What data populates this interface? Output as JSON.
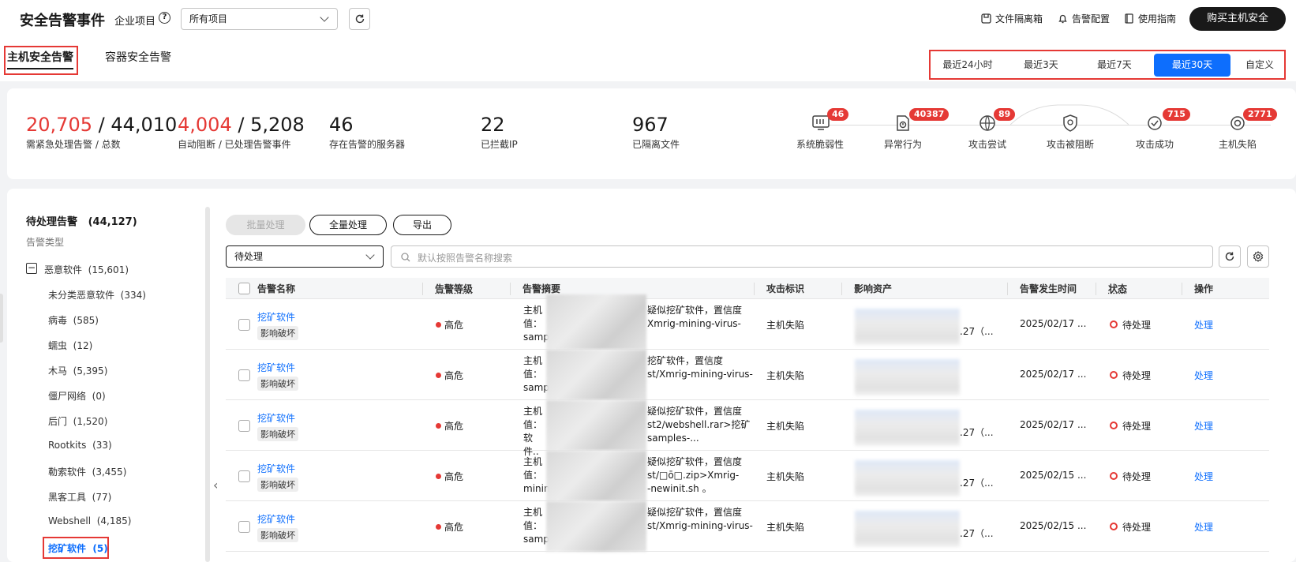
{
  "header": {
    "title": "安全告警事件",
    "project_label": "企业项目",
    "help_icon": "?",
    "project_select": "所有项目",
    "links": [
      {
        "label": "文件隔离箱",
        "icon": "file-box-icon"
      },
      {
        "label": "告警配置",
        "icon": "bell-icon"
      },
      {
        "label": "使用指南",
        "icon": "book-icon"
      }
    ],
    "buy_button": "购买主机安全"
  },
  "tabs": [
    "主机安全告警",
    "容器安全告警"
  ],
  "time_ranges": [
    "最近24小时",
    "最近3天",
    "最近7天",
    "最近30天",
    "自定义"
  ],
  "time_range_active": "最近30天",
  "stats": [
    {
      "value_red": "20,705",
      "sep": " / ",
      "value": "44,010",
      "label": "需紧急处理告警 / 总数"
    },
    {
      "value_red": "4,004",
      "sep": " / ",
      "value": "5,208",
      "label": "自动阻断 / 已处理告警事件"
    },
    {
      "value": "46",
      "label": "存在告警的服务器"
    },
    {
      "value": "22",
      "label": "已拦截IP"
    },
    {
      "value": "967",
      "label": "已隔离文件"
    }
  ],
  "flow": [
    {
      "label": "系统脆弱性",
      "badge": "46",
      "icon": "vulnerability-icon"
    },
    {
      "label": "异常行为",
      "badge": "40387",
      "icon": "abnormal-behavior-icon"
    },
    {
      "label": "攻击尝试",
      "badge": "89",
      "icon": "globe-attack-icon"
    },
    {
      "label": "攻击被阻断",
      "badge": "",
      "icon": "shield-blocked-icon"
    },
    {
      "label": "攻击成功",
      "badge": "715",
      "icon": "attack-success-icon"
    },
    {
      "label": "主机失陷",
      "badge": "2771",
      "icon": "host-compromised-icon"
    }
  ],
  "sidebar": {
    "title": "待处理告警",
    "count": "(44,127)",
    "subtitle": "告警类型",
    "group": {
      "label": "恶意软件",
      "count": "(15,601)"
    },
    "items": [
      {
        "label": "未分类恶意软件",
        "count": "(334)"
      },
      {
        "label": "病毒",
        "count": "(585)"
      },
      {
        "label": "蠕虫",
        "count": "(12)"
      },
      {
        "label": "木马",
        "count": "(5,395)"
      },
      {
        "label": "僵尸网络",
        "count": "(0)"
      },
      {
        "label": "后门",
        "count": "(1,520)"
      },
      {
        "label": "Rootkits",
        "count": "(33)"
      },
      {
        "label": "勒索软件",
        "count": "(3,455)"
      },
      {
        "label": "黑客工具",
        "count": "(77)"
      },
      {
        "label": "Webshell",
        "count": "(4,185)"
      },
      {
        "label": "挖矿软件",
        "count": "(5)"
      }
    ]
  },
  "toolbar": {
    "batch": "批量处理",
    "all": "全量处理",
    "export": "导出",
    "status_select": "待处理",
    "search_placeholder": "默认按照告警名称搜索"
  },
  "table": {
    "columns": [
      "告警名称",
      "告警等级",
      "告警摘要",
      "攻击标识",
      "影响资产",
      "告警发生时间",
      "状态",
      "操作"
    ],
    "rows": [
      {
        "name": "挖矿软件",
        "tag": "影响破坏",
        "level": "高危",
        "summary": [
          "主机",
          "疑似挖矿软件，置信度",
          "值：",
          "Xmrig-mining-virus-",
          "samp"
        ],
        "attack": "主机失陷",
        "asset_tail": ".27（...",
        "time": "2025/02/17 ...",
        "status": "待处理",
        "action": "处理"
      },
      {
        "name": "挖矿软件",
        "tag": "影响破坏",
        "level": "高危",
        "summary": [
          "主机",
          "挖矿软件，置信度",
          "值：",
          "st/Xmrig-mining-virus-",
          "samp"
        ],
        "attack": "主机失陷",
        "asset_tail": "",
        "time": "2025/02/17 ...",
        "status": "待处理",
        "action": "处理"
      },
      {
        "name": "挖矿软件",
        "tag": "影响破坏",
        "level": "高危",
        "summary": [
          "主机",
          "疑似挖矿软件，置信度",
          "值：",
          "st2/webshell.rar>挖矿",
          "软件..",
          "samples-..."
        ],
        "attack": "主机失陷",
        "asset_tail": ".27（...",
        "time": "2025/02/17 ...",
        "status": "待处理",
        "action": "处理"
      },
      {
        "name": "挖矿软件",
        "tag": "影响破坏",
        "level": "高危",
        "summary": [
          "主机",
          "疑似挖矿软件，置信度",
          "值：",
          "st/□ō□.zip>Xmrig-",
          "minin",
          "-newinit.sh 。"
        ],
        "attack": "主机失陷",
        "asset_tail": ".27（...",
        "time": "2025/02/15 ...",
        "status": "待处理",
        "action": "处理"
      },
      {
        "name": "挖矿软件",
        "tag": "影响破坏",
        "level": "高危",
        "summary": [
          "主机",
          "疑似挖矿软件，置信度",
          "值：",
          "st/Xmrig-mining-virus-",
          "samp"
        ],
        "attack": "主机失陷",
        "asset_tail": ".27（...",
        "time": "2025/02/15 ...",
        "status": "待处理",
        "action": "处理"
      }
    ]
  },
  "colors": {
    "accent": "#0d6efd",
    "danger": "#e53935",
    "dark": "#191919"
  }
}
